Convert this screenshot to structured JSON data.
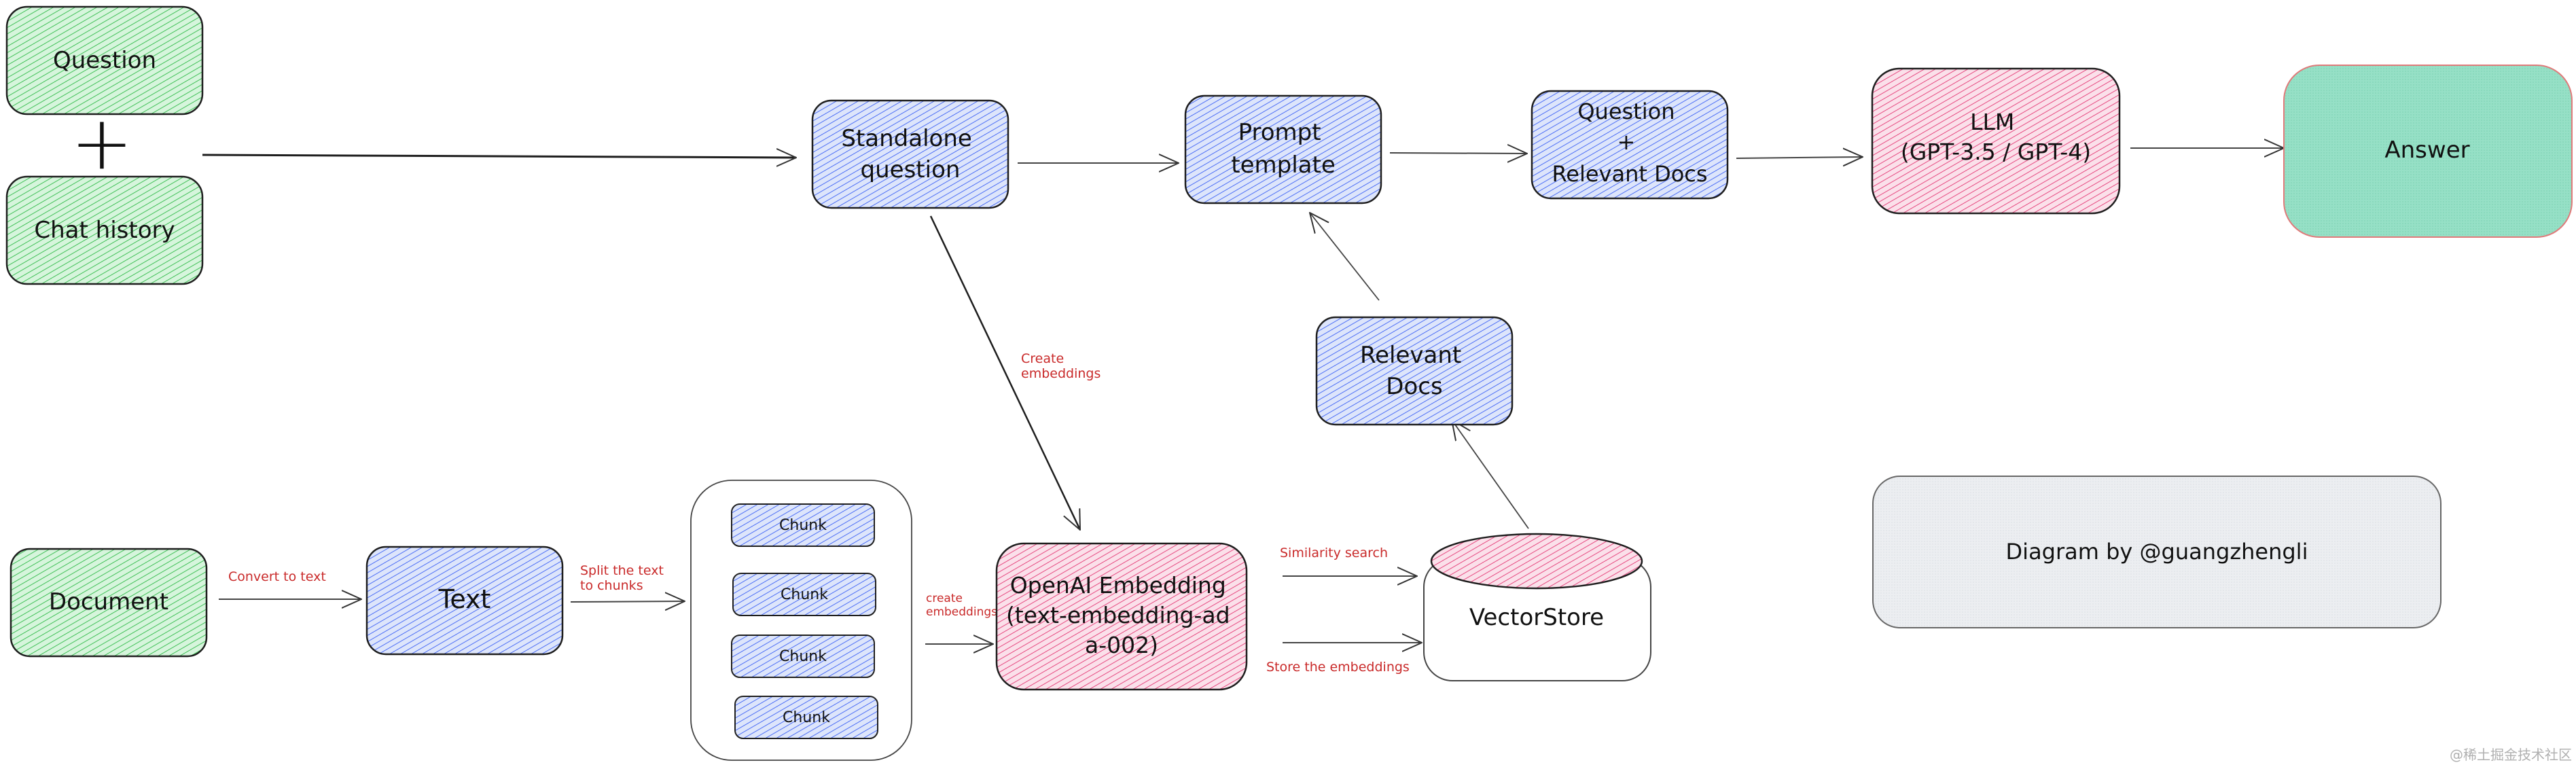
{
  "diagram": {
    "colors": {
      "green": "#b2f2bb",
      "green_hatch": "#40c057",
      "blue": "#d0dcf8",
      "blue_hatch": "#4c6ef5",
      "pink": "#fcc2d7",
      "pink_hatch": "#e64980",
      "teal": "#96e0c6",
      "gray": "#e9ecef",
      "label_red": "#c92a2a",
      "stroke": "#1e1e1e"
    },
    "nodes": {
      "question": {
        "lines": [
          "Question"
        ],
        "fill": "green"
      },
      "chat_history": {
        "lines": [
          "Chat history"
        ],
        "fill": "green"
      },
      "plus_symbol": "+",
      "standalone_question": {
        "lines": [
          "Standalone",
          "question"
        ],
        "fill": "blue"
      },
      "prompt_template": {
        "lines": [
          "Prompt",
          "template"
        ],
        "fill": "blue"
      },
      "question_relevant_docs": {
        "lines": [
          "Question",
          "+",
          "Relevant Docs"
        ],
        "fill": "blue"
      },
      "llm": {
        "lines": [
          "LLM",
          "(GPT-3.5 / GPT-4)"
        ],
        "fill": "pink"
      },
      "answer": {
        "lines": [
          "Answer"
        ],
        "fill": "teal"
      },
      "relevant_docs": {
        "lines": [
          "Relevant",
          "Docs"
        ],
        "fill": "blue"
      },
      "document": {
        "lines": [
          "Document"
        ],
        "fill": "green"
      },
      "text": {
        "lines": [
          "Text"
        ],
        "fill": "blue"
      },
      "chunks": [
        {
          "label": "Chunk"
        },
        {
          "label": "Chunk"
        },
        {
          "label": "Chunk"
        },
        {
          "label": "Chunk"
        }
      ],
      "openai_embedding": {
        "lines": [
          "OpenAI Embedding",
          "(text-embedding-ad",
          "a-002)"
        ],
        "fill": "pink"
      },
      "vectorstore": {
        "lines": [
          "VectorStore"
        ],
        "fill": "pink"
      },
      "credit": {
        "lines": [
          "Diagram by @guangzhengli"
        ],
        "fill": "gray"
      }
    },
    "edge_labels": {
      "create_embeddings_top": [
        "Create",
        "embeddings"
      ],
      "convert_to_text": [
        "Convert to text"
      ],
      "split_text": [
        "Split the text",
        "to chunks"
      ],
      "create_embeddings_chunks": [
        "create",
        "embeddings"
      ],
      "similarity_search": [
        "Similarity search"
      ],
      "store_embeddings": [
        "Store the embeddings"
      ]
    },
    "watermark": "@稀土掘金技术社区"
  }
}
